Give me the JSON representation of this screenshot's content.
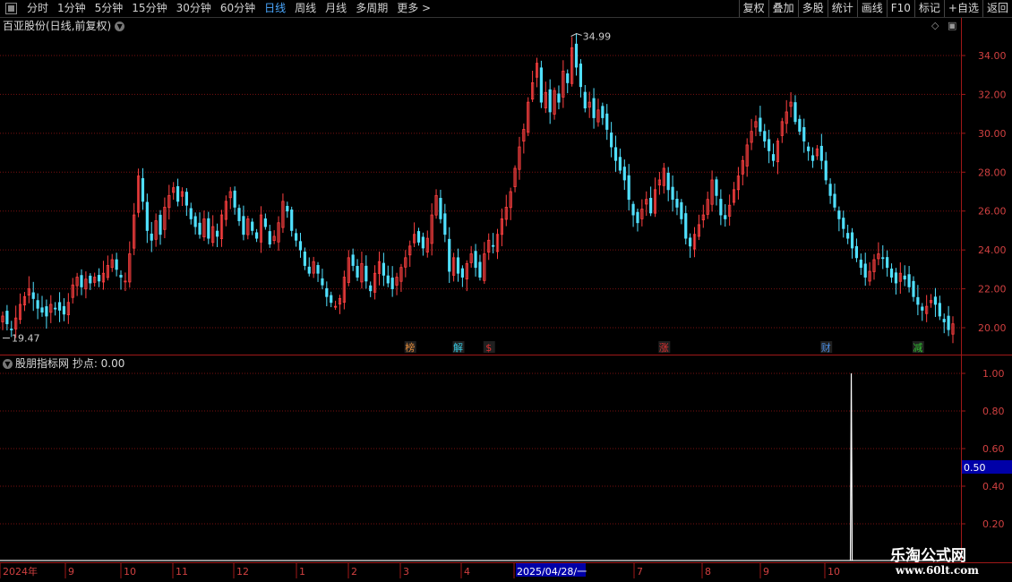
{
  "toolbar": {
    "periods": [
      "分时",
      "1分钟",
      "5分钟",
      "15分钟",
      "30分钟",
      "60分钟",
      "日线",
      "周线",
      "月线",
      "多周期",
      "更多 >"
    ],
    "active_period": "日线",
    "buttons": [
      "复权",
      "叠加",
      "多股",
      "统计",
      "画线",
      "F10",
      "标记",
      "+自选",
      "返回"
    ]
  },
  "main_panel": {
    "title": "百亚股份(日线,前复权)",
    "high_label": "34.99",
    "low_label": "19.47",
    "y_ticks": [
      "34.00",
      "32.00",
      "30.00",
      "28.00",
      "26.00",
      "24.00",
      "22.00",
      "20.00"
    ],
    "event_markers": [
      {
        "text": "榜",
        "color": "#e08a3a"
      },
      {
        "text": "解",
        "color": "#35c8e0"
      },
      {
        "text": "$",
        "color": "#e03030"
      },
      {
        "text": "涨",
        "color": "#e03030"
      },
      {
        "text": "财",
        "color": "#4a8ce0"
      },
      {
        "text": "减",
        "color": "#30c030"
      }
    ]
  },
  "sub_panel": {
    "title": "股朋指标网 抄点: 0.00",
    "y_ticks": [
      "1.00",
      "0.80",
      "0.60",
      "0.40",
      "0.20"
    ],
    "current_value": "0.50"
  },
  "x_axis": {
    "labels": [
      "2024年",
      "9",
      "10",
      "11",
      "12",
      "1",
      "2",
      "3",
      "4",
      "2025/04/28/一",
      "7",
      "8",
      "9",
      "10"
    ]
  },
  "watermark": {
    "line1": "乐淘公式网",
    "line2": "www.60lt.com"
  },
  "colors": {
    "up": "#ff4040",
    "down": "#50e0ff",
    "grid": "#7a1010",
    "axis": "#a01818",
    "highlight": "#0000a8"
  },
  "chart_data": {
    "type": "candlestick",
    "price_range": [
      19.0,
      35.5
    ],
    "close_series": [
      20.6,
      20.2,
      19.9,
      20.5,
      21.2,
      21.6,
      22.0,
      21.5,
      21.0,
      20.8,
      20.6,
      21.2,
      21.0,
      20.9,
      20.7,
      21.3,
      22.2,
      22.6,
      22.1,
      22.5,
      22.3,
      22.6,
      22.4,
      22.8,
      23.2,
      23.5,
      23.0,
      22.6,
      22.4,
      23.8,
      25.8,
      27.8,
      26.5,
      25.0,
      24.5,
      25.5,
      24.8,
      26.2,
      26.8,
      27.2,
      26.5,
      27.0,
      26.3,
      25.6,
      25.2,
      24.8,
      25.6,
      24.6,
      25.2,
      24.7,
      25.8,
      26.5,
      27.0,
      26.2,
      25.5,
      24.8,
      25.6,
      25.0,
      24.6,
      25.8,
      25.2,
      24.3,
      24.7,
      25.4,
      26.5,
      26.0,
      25.0,
      24.5,
      24.0,
      23.2,
      22.8,
      23.4,
      22.8,
      22.2,
      21.6,
      21.3,
      21.1,
      21.5,
      22.6,
      23.6,
      23.2,
      22.6,
      23.3,
      22.4,
      21.9,
      22.8,
      23.4,
      22.7,
      22.3,
      22.0,
      22.6,
      23.1,
      23.6,
      24.2,
      24.8,
      24.4,
      24.1,
      24.6,
      25.8,
      26.8,
      25.6,
      24.8,
      22.9,
      23.6,
      22.8,
      22.6,
      23.3,
      23.8,
      23.1,
      22.6,
      23.8,
      24.5,
      24.2,
      24.8,
      25.6,
      26.2,
      27.0,
      28.2,
      29.3,
      30.2,
      31.6,
      32.6,
      33.6,
      31.6,
      32.1,
      31.1,
      32.2,
      31.6,
      33.2,
      32.6,
      34.4,
      33.4,
      32.4,
      31.3,
      31.6,
      30.8,
      31.2,
      30.8,
      30.2,
      29.3,
      28.6,
      28.1,
      27.6,
      26.6,
      25.8,
      25.4,
      26.1,
      26.6,
      25.9,
      27.1,
      27.6,
      28.2,
      27.1,
      26.6,
      26.2,
      25.6,
      24.6,
      24.2,
      24.8,
      25.3,
      25.8,
      26.6,
      27.6,
      26.8,
      25.8,
      25.6,
      26.3,
      27.1,
      27.8,
      28.6,
      29.4,
      30.1,
      30.6,
      30.1,
      29.6,
      29.1,
      28.6,
      29.6,
      30.6,
      31.1,
      31.6,
      30.6,
      30.1,
      29.6,
      29.1,
      28.6,
      29.2,
      28.6,
      27.6,
      26.8,
      26.2,
      25.6,
      25.1,
      24.6,
      24.1,
      23.6,
      23.1,
      22.6,
      22.9,
      23.5,
      23.8,
      23.6,
      23.1,
      22.6,
      22.3,
      22.8,
      22.5,
      22.1,
      21.6,
      21.2,
      20.9,
      21.1,
      21.4,
      21.2,
      20.6,
      20.3,
      19.9,
      20.2
    ]
  }
}
